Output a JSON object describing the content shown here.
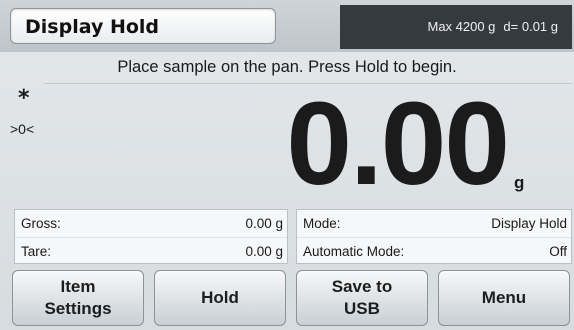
{
  "header": {
    "title": "Display Hold",
    "capacity": "Max 4200 g",
    "readability": "d= 0.01 g"
  },
  "instruction": "Place sample on the pan. Press Hold to begin.",
  "indicators": {
    "stable_symbol": "*",
    "center_zero": ">0<"
  },
  "weight": {
    "value": "0.00",
    "unit": "g"
  },
  "info_left": {
    "rows": [
      {
        "label": "Gross:",
        "value": "0.00 g"
      },
      {
        "label": "Tare:",
        "value": "0.00 g"
      }
    ]
  },
  "info_right": {
    "rows": [
      {
        "label": "Mode:",
        "value": "Display Hold"
      },
      {
        "label": "Automatic Mode:",
        "value": "Off"
      }
    ]
  },
  "buttons": [
    {
      "label": "Item\nSettings"
    },
    {
      "label": "Hold"
    },
    {
      "label": "Save to\nUSB"
    },
    {
      "label": "Menu"
    }
  ],
  "colors": {
    "header_dark": "#353a3e",
    "background": "#dde1e4"
  }
}
